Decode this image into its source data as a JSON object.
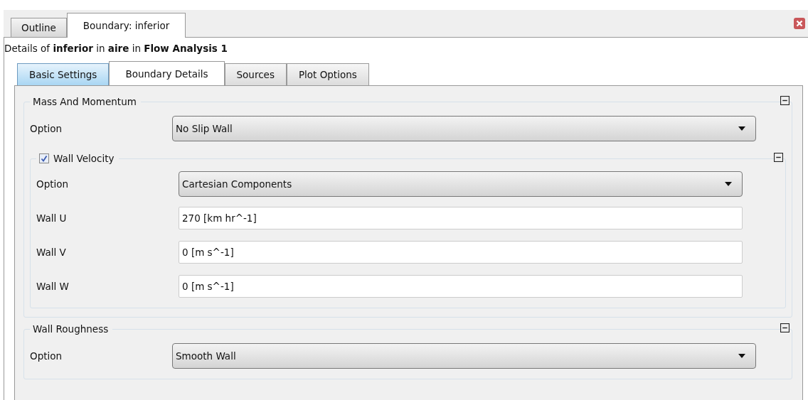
{
  "tabs": [
    {
      "label": "Outline",
      "selected": false
    },
    {
      "label": "Boundary: inferior",
      "selected": true
    }
  ],
  "heading": "Details of **inferior** in **aire** in **Flow Analysis 1**",
  "subtabs": [
    {
      "label": "Basic Settings",
      "selected": false,
      "highlighted": true
    },
    {
      "label": "Boundary Details",
      "selected": true,
      "highlighted": false
    },
    {
      "label": "Sources",
      "selected": false,
      "highlighted": false
    },
    {
      "label": "Plot Options",
      "selected": false,
      "highlighted": false
    }
  ],
  "sections": [
    {
      "kind": "group",
      "title": "Mass And Momentum",
      "expanded": true,
      "rows": [
        {
          "kind": "select",
          "label": "Option",
          "value": "No Slip Wall"
        },
        {
          "kind": "group",
          "title": "Wall Velocity",
          "checkbox": true,
          "checked": true,
          "expanded": true,
          "rows": [
            {
              "kind": "select",
              "label": "Option",
              "value": "Cartesian Components"
            },
            {
              "kind": "text",
              "label": "Wall U",
              "value": "270 [km hr^-1]"
            },
            {
              "kind": "text",
              "label": "Wall V",
              "value": "0 [m s^-1]"
            },
            {
              "kind": "text",
              "label": "Wall W",
              "value": "0 [m s^-1]"
            }
          ]
        }
      ]
    },
    {
      "kind": "group",
      "title": "Wall Roughness",
      "expanded": true,
      "rows": [
        {
          "kind": "select",
          "label": "Option",
          "value": "Smooth Wall"
        }
      ]
    }
  ]
}
